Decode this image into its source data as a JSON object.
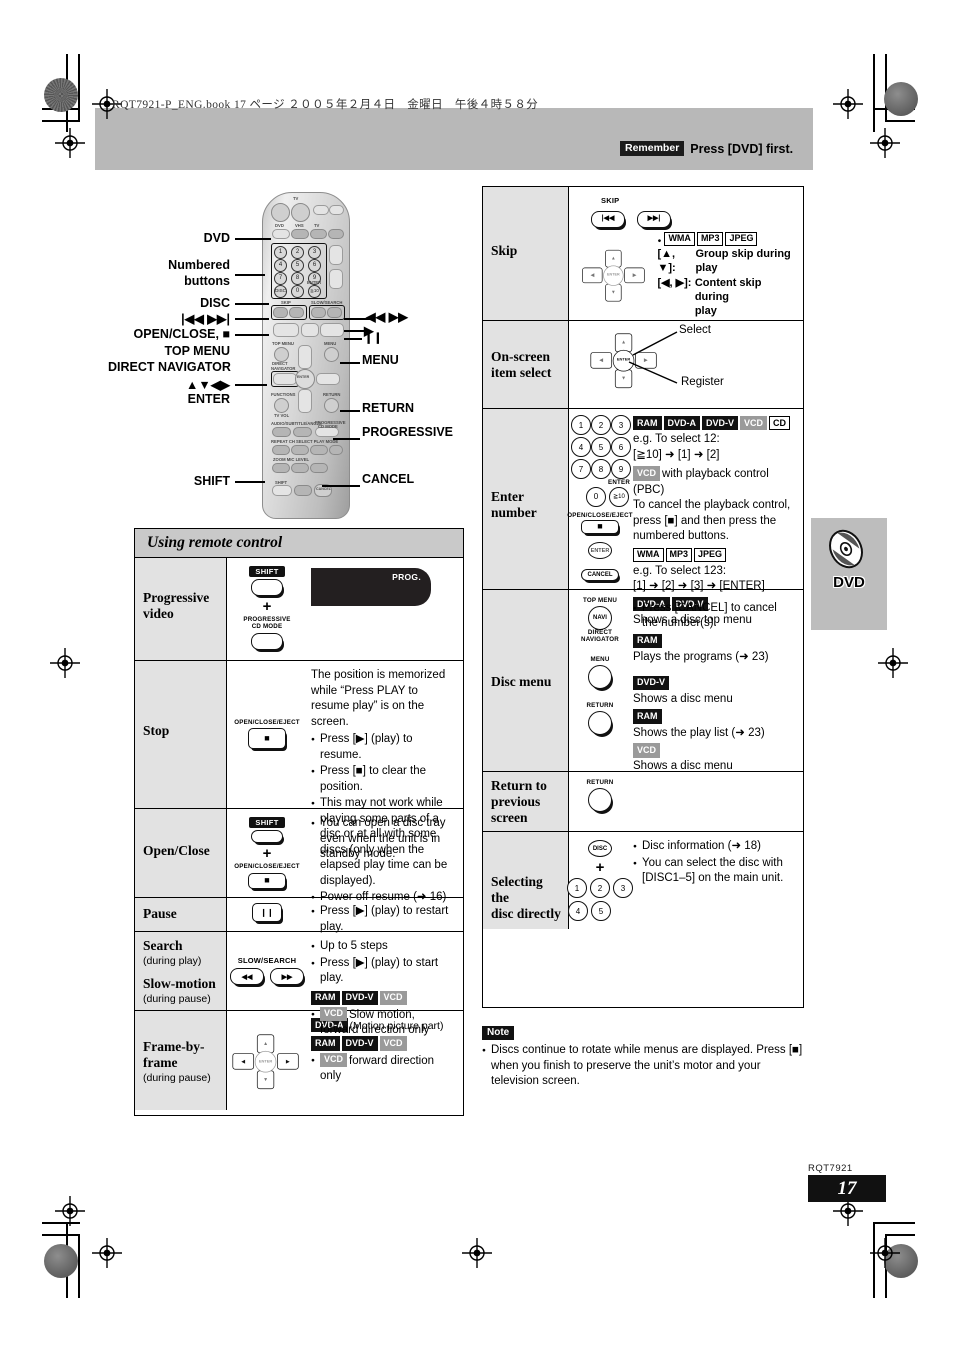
{
  "print_header": "RQT7921-P_ENG.book  17 ページ  ２００５年２月４日　金曜日　午後４時５８分",
  "remember": {
    "tag": "Remember",
    "text": "Press [DVD] first."
  },
  "side_tab": {
    "label": "DVD",
    "icon": "disc-icon"
  },
  "footer": {
    "code": "RQT7921",
    "page": "17"
  },
  "remote_callouts": {
    "left": [
      "DVD",
      "Numbered\nbuttons",
      "DISC",
      "OPEN/CLOSE, ■",
      "TOP MENU",
      "DIRECT NAVIGATOR",
      "ENTER",
      "SHIFT"
    ],
    "dvd": "DVD",
    "numbered_1": "Numbered",
    "numbered_2": "buttons",
    "disc": "DISC",
    "skip": "◀◀ ▶▶",
    "skip_glyph": "|◀◀  ▶▶|",
    "openclose": "OPEN/CLOSE, ■",
    "topmenu": "TOP MENU",
    "directnav": "DIRECT NAVIGATOR",
    "cursor": "▲▼◀▶",
    "enter": "ENTER",
    "shift": "SHIFT",
    "search_glyph": "◀◀  ▶▶",
    "play": "▶",
    "pause": "❙❙",
    "menu": "MENU",
    "return": "RETURN",
    "progressive": "PROGRESSIVE",
    "cancel": "CANCEL"
  },
  "remote_keys": {
    "dvd": "DVD",
    "vhs": "VHS",
    "tv": "TV",
    "enter": "ENTER",
    "topmenu": "TOP MENU",
    "navi": "NAVI",
    "direct": "DIRECT",
    "navigator": "NAVIGATOR",
    "menu": "MENU",
    "return": "RETURN",
    "functions": "FUNCTIONS",
    "tvvol": "TV VOL",
    "progressive": "PROGRESSIVE",
    "cdmode": "CD MODE",
    "cancel": "CANCEL",
    "shift": "SHIFT",
    "skip": "SKIP",
    "slowsearch": "SLOW/SEARCH"
  },
  "left_table": {
    "title": "Using remote control",
    "rows": [
      {
        "label": "Progressive video",
        "label_line1": "Progressive",
        "label_line2": "video",
        "sub": "",
        "keys": {
          "shift": "SHIFT",
          "plus": "+",
          "line1": "PROGRESSIVE",
          "line2": "CD MODE"
        },
        "display": "PROG.",
        "desc_intro": "",
        "bullets": []
      },
      {
        "label": "Stop",
        "sub": "",
        "keys": {
          "top_label": "OPEN/CLOSE/EJECT",
          "glyph": "■"
        },
        "desc_intro": "The position is memorized while “Press PLAY to resume play” is on the screen.",
        "bullets": [
          "Press [▶] (play) to resume.",
          "Press [■] to clear the position.",
          "This may not work while playing some parts of a disc or at all with some discs (only when the elapsed play time can be displayed).",
          "Power off resume (➜ 16)"
        ]
      },
      {
        "label": "Open/Close",
        "sub": "",
        "keys": {
          "shift": "SHIFT",
          "plus": "+",
          "top_label": "OPEN/CLOSE/EJECT",
          "glyph": "■"
        },
        "desc_intro": "",
        "bullets": [
          "You can open a disc tray even when the unit is in standby mode."
        ]
      },
      {
        "label": "Pause",
        "sub": "",
        "keys": {
          "glyph": "❙❙"
        },
        "desc_intro": "",
        "bullets": [
          "Press [▶] (play) to restart play."
        ]
      },
      {
        "label": "Search",
        "sub": "(during play)",
        "label2": "Slow-motion",
        "sub2": "(during pause)",
        "keys": {
          "top_label": "SLOW/SEARCH",
          "left": "◀◀",
          "right": "▶▶"
        },
        "bullets": [
          "Up to 5 steps",
          "Press [▶] (play) to start play."
        ],
        "badges": [
          "RAM",
          "DVD-V",
          "VCD"
        ],
        "badge_note_prefix": "VCD",
        "badge_note": "Slow motion, forward direction only"
      },
      {
        "label": "Frame-by-frame",
        "label_line1": "Frame-by-",
        "label_line2": "frame",
        "sub": "(during pause)",
        "keys": {
          "pad": "cursor-pad"
        },
        "badges_a": [
          "DVD-A"
        ],
        "badge_a_note": "(Motion picture part)",
        "badges_b": [
          "RAM",
          "DVD-V",
          "VCD"
        ],
        "badge_note_prefix": "VCD",
        "badge_note": "forward direction only"
      }
    ]
  },
  "right_table": {
    "rows": [
      {
        "label": "Skip",
        "keys": {
          "top_label": "SKIP",
          "left": "|◀◀",
          "right": "▶▶|",
          "pad": "cursor-pad"
        },
        "badges": [
          "WMA",
          "MP3",
          "JPEG"
        ],
        "lines": [
          {
            "key": "[▲, ▼]:",
            "val_1": "Group skip during",
            "val_2": "play"
          },
          {
            "key": "[◀, ▶]:",
            "val_1": "Content skip during",
            "val_2": "play"
          }
        ]
      },
      {
        "label": "On-screen item select",
        "label_line1": "On-screen",
        "label_line2": "item select",
        "keys": {
          "pad": "cursor-pad"
        },
        "annotations": [
          "Select",
          "Register"
        ]
      },
      {
        "label": "Enter number",
        "keys": {
          "numbers": [
            "1",
            "2",
            "3",
            "4",
            "5",
            "6",
            "7",
            "8",
            "9",
            "0",
            "≧10"
          ],
          "enter_label": "ENTER",
          "stop_label": "OPEN/CLOSE/EJECT",
          "stop_glyph": "■",
          "enter_btn": "ENTER",
          "cancel_btn": "CANCEL"
        },
        "blocks": [
          {
            "badges": [
              "RAM",
              "DVD-A",
              "DVD-V",
              "VCD",
              "CD"
            ],
            "lines": [
              "e.g. To select 12:",
              "[≧10] ➜ [1] ➜ [2]"
            ]
          },
          {
            "badges": [
              "VCD"
            ],
            "inline": "with playback control (PBC)",
            "lines": [
              "To cancel the playback control, press [■] and then press the numbered buttons."
            ]
          },
          {
            "badges": [
              "WMA",
              "MP3",
              "JPEG"
            ],
            "lines": [
              "e.g. To select 123:",
              "[1] ➜ [2] ➜ [3] ➜ [ENTER]"
            ]
          }
        ],
        "bullets": [
          "Press [CANCEL] to cancel the number(s)."
        ]
      },
      {
        "label": "Disc menu",
        "keys": {
          "topmenu": "TOP MENU",
          "navi": "NAVI",
          "direct": "DIRECT",
          "navigator": "NAVIGATOR",
          "menu": "MENU",
          "return": "RETURN"
        },
        "blocks": [
          {
            "badges": [
              "DVD-A",
              "DVD-V"
            ],
            "lines": [
              "Shows a disc top menu"
            ]
          },
          {
            "badges": [
              "RAM"
            ],
            "lines": [
              "Plays the programs (➜ 23)"
            ]
          },
          {
            "badges": [
              "DVD-V"
            ],
            "lines": [
              "Shows a disc menu"
            ]
          },
          {
            "badges": [
              "RAM"
            ],
            "lines": [
              "Shows the play list (➜ 23)"
            ]
          },
          {
            "badges": [
              "VCD"
            ],
            "lines": [
              "Shows a disc menu"
            ]
          }
        ]
      },
      {
        "label": "Return to previous screen",
        "label_line1": "Return to",
        "label_line2": "previous",
        "label_line3": "screen",
        "keys": {
          "return": "RETURN"
        },
        "blocks": []
      },
      {
        "label": "Selecting the disc directly",
        "label_line1": "Selecting the",
        "label_line2": "disc directly",
        "keys": {
          "disc": "DISC",
          "plus": "+",
          "numbers": [
            "1",
            "2",
            "3",
            "4",
            "5"
          ]
        },
        "bullets": [
          "Disc information (➜ 18)",
          "You can select the disc with [DISC1–5] on the main unit."
        ]
      }
    ]
  },
  "note": {
    "tag": "Note",
    "text": "Discs continue to rotate while menus are displayed. Press [■] when you finish to preserve the unit’s motor and your television screen."
  }
}
